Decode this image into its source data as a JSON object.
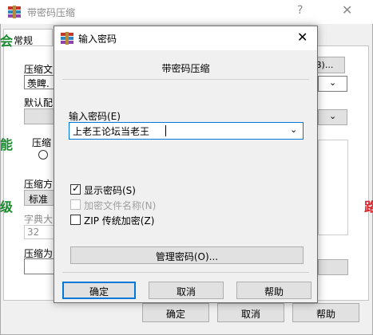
{
  "background_window": {
    "title": "带密码压缩",
    "help_glyph": "?",
    "close_glyph": "✕",
    "tab_general": "常规",
    "label_archive_name": "压缩文",
    "archive_name_value": "羡睥.",
    "label_default_profile": "默认配",
    "label_format": "压缩",
    "label_method": "压缩方",
    "method_value": "标准",
    "label_dict_size": "字典大",
    "dict_value": "32",
    "label_volume": "压缩为",
    "browse_label": "B)...",
    "ok_label": "确定",
    "cancel_label": "取消",
    "help_label": "帮助",
    "edge_left_top": "会",
    "edge_left_mid": "能",
    "edge_left_bottom": "级",
    "edge_right": "路",
    "chevron": "⌄"
  },
  "dialog": {
    "title": "输入密码",
    "close_glyph": "✕",
    "subtitle": "带密码压缩",
    "password_label": "输入密码(E)",
    "password_value": "上老王论坛当老王",
    "chevron": "⌄",
    "show_password_label": "显示密码(S)",
    "show_password_checked": true,
    "encrypt_names_label": "加密文件名称(N)",
    "encrypt_names_checked": false,
    "zip_legacy_label": "ZIP 传统加密(Z)",
    "zip_legacy_checked": false,
    "manage_button_label": "管理密码(O)...",
    "ok_label": "确定",
    "cancel_label": "取消",
    "help_label": "帮助"
  },
  "colors": {
    "edge_green": "#1a8a2e",
    "edge_red": "#d9272e",
    "accent_blue": "#0078d7"
  }
}
